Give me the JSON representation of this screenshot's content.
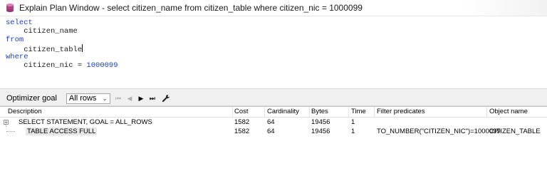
{
  "window": {
    "title": "Explain Plan Window - select citizen_name from citizen_table where citizen_nic = 1000099"
  },
  "editor": {
    "lines": [
      {
        "kw": "select",
        "rest": ""
      },
      {
        "kw": "",
        "rest": "    citizen_name"
      },
      {
        "kw": "from",
        "rest": ""
      },
      {
        "kw": "",
        "rest": "    citizen_table"
      },
      {
        "kw": "where",
        "rest": ""
      },
      {
        "kw": "",
        "rest": "    citizen_nic = ",
        "num": "1000099"
      }
    ]
  },
  "toolbar": {
    "optimizer_goal_label": "Optimizer goal",
    "optimizer_goal_value": "All rows",
    "icons": [
      "first-icon",
      "previous-icon",
      "next-icon",
      "last-icon",
      "wrench-icon"
    ]
  },
  "grid": {
    "columns": [
      "Description",
      "Cost",
      "Cardinality",
      "Bytes",
      "Time",
      "Filter predicates",
      "Object name"
    ],
    "rows": [
      {
        "description": "SELECT STATEMENT, GOAL = ALL_ROWS",
        "cost": "1582",
        "cardinality": "64",
        "bytes": "19456",
        "time": "1",
        "filter": "",
        "object": ""
      },
      {
        "description": "TABLE ACCESS FULL",
        "cost": "1582",
        "cardinality": "64",
        "bytes": "19456",
        "time": "1",
        "filter": "TO_NUMBER(\"CITIZEN_NIC\")=1000099",
        "object": "CITIZEN_TABLE"
      }
    ]
  },
  "colors": {
    "keyword": "#1a3fc9",
    "toolbar_bg": "#f0f0f0"
  }
}
